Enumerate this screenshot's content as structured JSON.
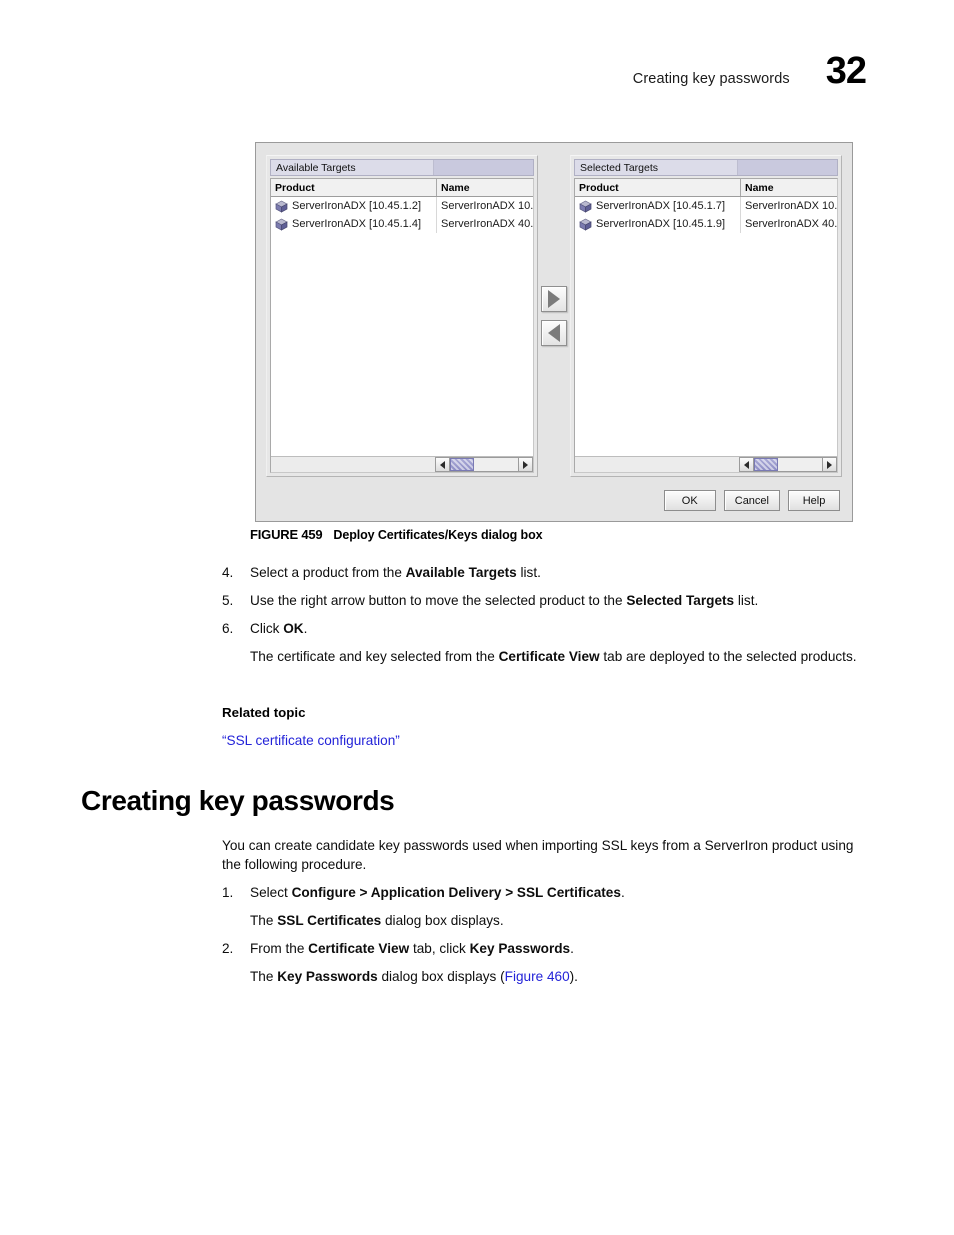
{
  "header": {
    "title": "Creating key passwords",
    "page_number": "32"
  },
  "figure": {
    "label": "FIGURE 459",
    "caption": "Deploy Certificates/Keys dialog box",
    "dialog": {
      "panels": [
        {
          "title": "Available Targets",
          "columns": [
            "Product",
            "Name"
          ],
          "rows": [
            {
              "icon": "device-icon",
              "product": "ServerIronADX [10.45.1.2]",
              "name": "ServerIronADX 10..."
            },
            {
              "icon": "device-icon",
              "product": "ServerIronADX [10.45.1.4]",
              "name": "ServerIronADX 40..."
            }
          ]
        },
        {
          "title": "Selected Targets",
          "columns": [
            "Product",
            "Name"
          ],
          "rows": [
            {
              "icon": "device-icon",
              "product": "ServerIronADX [10.45.1.7]",
              "name": "ServerIronADX 10..."
            },
            {
              "icon": "device-icon",
              "product": "ServerIronADX [10.45.1.9]",
              "name": "ServerIronADX 40..."
            }
          ]
        }
      ],
      "transfer_buttons": [
        {
          "icon": "arrow-right-icon",
          "name": "move-right-button"
        },
        {
          "icon": "arrow-left-icon",
          "name": "move-left-button"
        }
      ],
      "footer_buttons": [
        "OK",
        "Cancel",
        "Help"
      ],
      "scrollbar": {
        "left_arrow_icon": "triangle-left-icon",
        "right_arrow_icon": "triangle-right-icon"
      },
      "colors": {
        "dialog_background": "#e4e4e4",
        "panel_title_background": "#dcdce9",
        "list_background": "#ffffff",
        "scroll_thumb": "#9b9bd0"
      }
    }
  },
  "steps_upper": [
    {
      "num": "4.",
      "parts": [
        {
          "t": "Select a product from the ",
          "b": false
        },
        {
          "t": "Available Targets",
          "b": true
        },
        {
          "t": " list.",
          "b": false
        }
      ]
    },
    {
      "num": "5.",
      "parts": [
        {
          "t": "Use the right arrow button to move the selected product to the ",
          "b": false
        },
        {
          "t": "Selected Targets",
          "b": true
        },
        {
          "t": " list.",
          "b": false
        }
      ]
    },
    {
      "num": "6.",
      "parts": [
        {
          "t": "Click ",
          "b": false
        },
        {
          "t": "OK",
          "b": true
        },
        {
          "t": ".",
          "b": false
        }
      ]
    }
  ],
  "step6_result": [
    {
      "t": "The certificate and key selected from the ",
      "b": false
    },
    {
      "t": "Certificate View",
      "b": true
    },
    {
      "t": " tab are deployed to the selected products.",
      "b": false
    }
  ],
  "related": {
    "heading": "Related topic",
    "link": "“SSL certificate configuration”"
  },
  "section": {
    "title": "Creating key passwords",
    "intro": "You can create candidate key passwords used when importing SSL keys from a ServerIron product using the following procedure."
  },
  "steps_lower": [
    {
      "num": "1.",
      "parts": [
        {
          "t": "Select ",
          "b": false
        },
        {
          "t": "Configure > Application Delivery > SSL Certificates",
          "b": true
        },
        {
          "t": ".",
          "b": false
        }
      ],
      "result": [
        {
          "t": "The ",
          "b": false
        },
        {
          "t": "SSL Certificates",
          "b": true
        },
        {
          "t": " dialog box displays.",
          "b": false
        }
      ]
    },
    {
      "num": "2.",
      "parts": [
        {
          "t": "From the ",
          "b": false
        },
        {
          "t": "Certificate View",
          "b": true
        },
        {
          "t": " tab, click ",
          "b": false
        },
        {
          "t": "Key Passwords",
          "b": true
        },
        {
          "t": ".",
          "b": false
        }
      ],
      "result": [
        {
          "t": "The ",
          "b": false
        },
        {
          "t": "Key Passwords",
          "b": true
        },
        {
          "t": " dialog box displays (",
          "b": false
        },
        {
          "t": "Figure 460",
          "b": false,
          "link": true
        },
        {
          "t": ").",
          "b": false
        }
      ]
    }
  ]
}
